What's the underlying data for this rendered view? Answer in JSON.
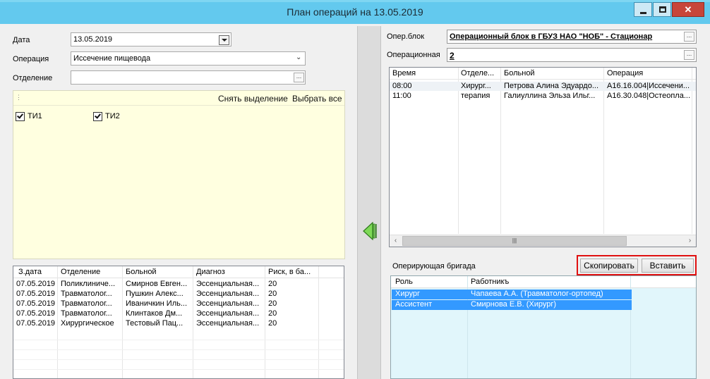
{
  "window": {
    "title": "План операций на 13.05.2019"
  },
  "left": {
    "date_label": "Дата",
    "date_value": "13.05.2019",
    "operation_label": "Операция",
    "operation_value": "Иссечение пищевода",
    "department_label": "Отделение",
    "department_value": "",
    "clear_selection": "Снять выделение",
    "select_all": "Выбрать все",
    "checkboxes": [
      {
        "label": "ТИ1",
        "checked": true
      },
      {
        "label": "ТИ2",
        "checked": true
      }
    ],
    "patients_table": {
      "columns": [
        "З.дата",
        "Отделение",
        "Больной",
        "Диагноз",
        "Риск, в ба..."
      ],
      "rows": [
        [
          "07.05.2019",
          "Поликлиниче...",
          "Смирнов Евген...",
          "Эссенциальная...",
          "20"
        ],
        [
          "07.05.2019",
          "Травматолог...",
          "Пушкин Алекс...",
          "Эссенциальная...",
          "20"
        ],
        [
          "07.05.2019",
          "Травматолог...",
          "Иваничкин Иль...",
          "Эссенциальная...",
          "20"
        ],
        [
          "07.05.2019",
          "Травматолог...",
          "Клинтаков Дм...",
          "Эссенциальная...",
          "20"
        ],
        [
          "07.05.2019",
          "Хирургическое",
          "Тестовый Пац...",
          "Эссенциальная...",
          "20"
        ]
      ]
    }
  },
  "right": {
    "op_block_label": "Опер.блок",
    "op_block_value": "Операционный блок в ГБУЗ НАО \"НОБ\" - Стационар",
    "op_room_label": "Операционная",
    "op_room_value": "2",
    "schedule_table": {
      "columns": [
        "Время",
        "Отделе...",
        "Больной",
        "Операция"
      ],
      "rows": [
        [
          "08:00",
          "Хирург...",
          "Петрова Алина Эдуардо...",
          "A16.16.004|Иссечени..."
        ],
        [
          "11:00",
          "терапия",
          "Галиуллина Эльза Ильг...",
          "A16.30.048|Остеопла..."
        ]
      ]
    },
    "team_label": "Оперирующая бригада",
    "copy_button": "Скопировать",
    "paste_button": "Вставить",
    "team_table": {
      "columns": [
        "Роль",
        "Работникъ"
      ],
      "rows": [
        [
          "Хирург",
          "Чапаева А.А. (Травматолог-ортопед)"
        ],
        [
          "Ассистент",
          "Смирнова Е.В. (Хирург)"
        ]
      ]
    }
  },
  "colors": {
    "titlebar": "#63c9ee",
    "selection": "#3399ff",
    "highlight": "#e01010",
    "yellow_panel": "#ffffe0",
    "team_panel": "#e1f6fb"
  }
}
